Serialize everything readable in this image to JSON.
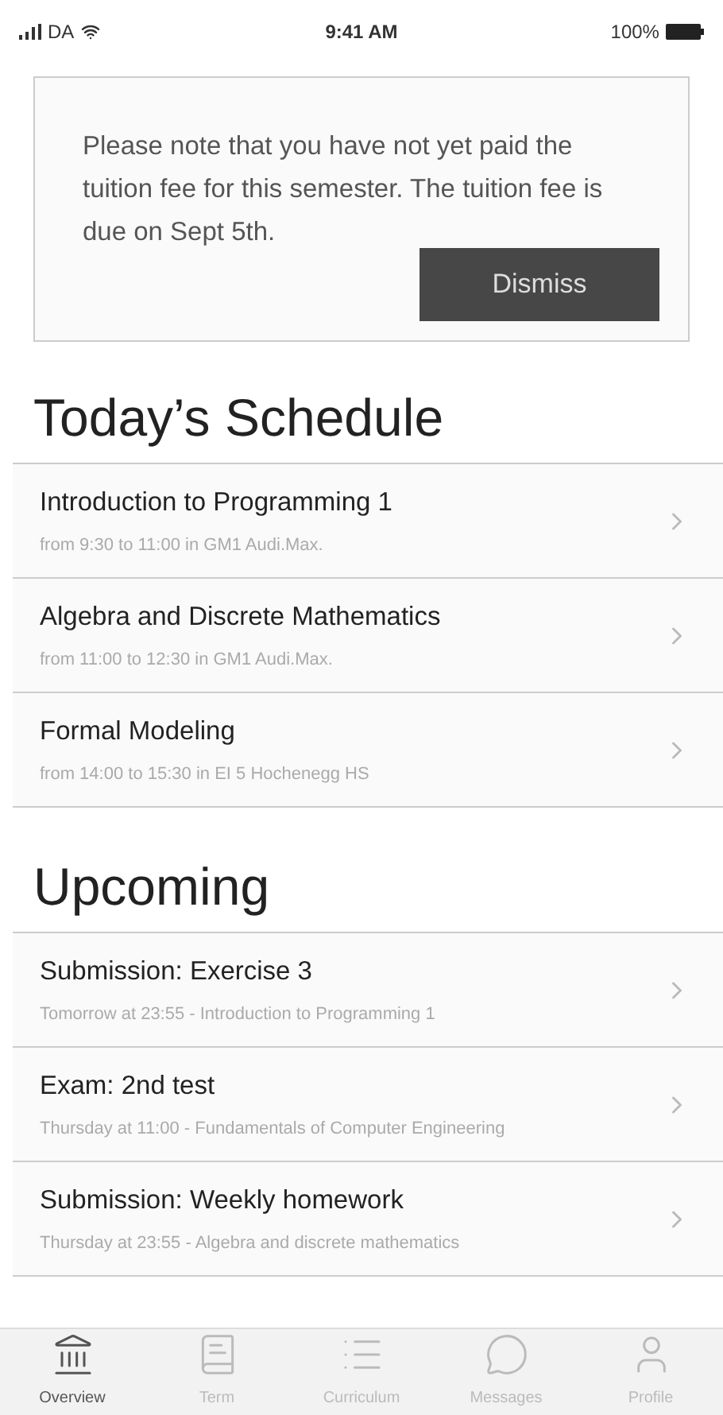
{
  "status_bar": {
    "carrier": "DA",
    "time": "9:41 AM",
    "battery": "100%"
  },
  "notice": {
    "text": "Please note that you have not yet paid the tuition fee for this semester. The tuition fee is due on Sept 5th.",
    "button": "Dismiss"
  },
  "sections": [
    {
      "title": "Today’s Schedule",
      "items": [
        {
          "title": "Introduction to Programming 1",
          "subtitle": "from 9:30 to 11:00 in GM1 Audi.Max."
        },
        {
          "title": "Algebra and Discrete Mathematics",
          "subtitle": "from 11:00 to 12:30 in GM1 Audi.Max."
        },
        {
          "title": "Formal Modeling",
          "subtitle": "from 14:00 to 15:30 in EI 5 Hochenegg HS"
        }
      ]
    },
    {
      "title": "Upcoming",
      "items": [
        {
          "title": "Submission: Exercise 3",
          "subtitle": "Tomorrow at 23:55 - Introduction to Programming 1"
        },
        {
          "title": "Exam: 2nd test",
          "subtitle": "Thursday at 11:00 - Fundamentals of Computer Engineering"
        },
        {
          "title": "Submission: Weekly homework",
          "subtitle": "Thursday at 23:55 - Algebra and discrete mathematics"
        }
      ]
    }
  ],
  "tab_bar": [
    {
      "kind": "overview",
      "label": "Overview",
      "selected": true
    },
    {
      "kind": "term",
      "label": "Term",
      "selected": false
    },
    {
      "kind": "curriculum",
      "label": "Curriculum",
      "selected": false
    },
    {
      "kind": "messages",
      "label": "Messages",
      "selected": false
    },
    {
      "kind": "profile",
      "label": "Profile",
      "selected": false
    }
  ]
}
